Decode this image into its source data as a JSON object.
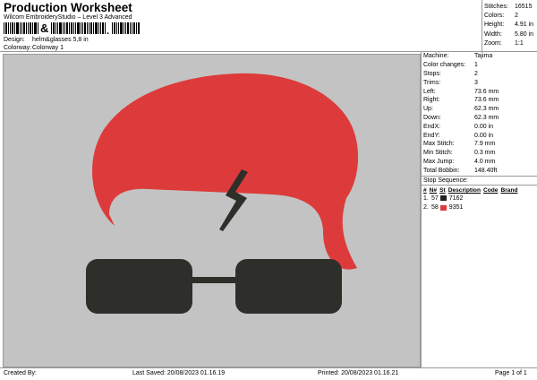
{
  "header": {
    "title": "Production Worksheet",
    "subtitle": "Wilcom EmbroideryStudio – Level 3 Advanced"
  },
  "meta": [
    {
      "label": "Design:",
      "value": "helm&glasses 5,8 in"
    },
    {
      "label": "Colorway:",
      "value": "Colorway 1"
    }
  ],
  "top_stats": [
    {
      "label": "Stitches:",
      "value": "16515"
    },
    {
      "label": "Colors:",
      "value": "2"
    },
    {
      "label": "Height:",
      "value": "4.91 in"
    },
    {
      "label": "Width:",
      "value": "5.80 in"
    },
    {
      "label": "Zoom:",
      "value": "1:1"
    }
  ],
  "machine_info": [
    {
      "label": "Machine:",
      "value": "Tajima"
    },
    {
      "label": "Color changes:",
      "value": "1"
    },
    {
      "label": "Stops:",
      "value": "2"
    },
    {
      "label": "Trims:",
      "value": "3"
    },
    {
      "label": "Left:",
      "value": "73.6 mm"
    },
    {
      "label": "Right:",
      "value": "73.6 mm"
    },
    {
      "label": "Up:",
      "value": "62.3 mm"
    },
    {
      "label": "Down:",
      "value": "62.3 mm"
    },
    {
      "label": "EndX:",
      "value": "0.00 in"
    },
    {
      "label": "EndY:",
      "value": "0.00 in"
    },
    {
      "label": "Max Stitch:",
      "value": "7.9 mm"
    },
    {
      "label": "Min Stitch:",
      "value": "0.3 mm"
    },
    {
      "label": "Max Jump:",
      "value": "4.0 mm"
    },
    {
      "label": "Total Bobbin:",
      "value": "148.40ft"
    }
  ],
  "stop_sequence": {
    "title": "Stop Sequence:",
    "headers": [
      "#",
      "N#",
      "St",
      "Description",
      "Code",
      "Brand"
    ],
    "rows": [
      {
        "num": "1.",
        "needle": "57",
        "color": "#222222",
        "code": "7162"
      },
      {
        "num": "2.",
        "needle": "58",
        "color": "#e03a3a",
        "code": "9351"
      }
    ]
  },
  "design_colors": {
    "helmet": "#dd3b3b",
    "glasses": "#2e2e2a",
    "background": "#c3c3c3"
  },
  "footer": {
    "created_by": "Created By:",
    "last_saved": "Last Saved: 20/08/2023 01.16.19",
    "printed": "Printed: 20/08/2023 01.16.21",
    "page": "Page 1 of 1"
  }
}
